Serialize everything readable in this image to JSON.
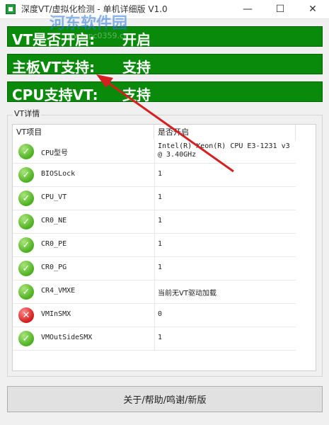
{
  "window": {
    "title": "深度VT/虚拟化检测 - 单机详细版 V1.0",
    "minimize": "—",
    "maximize": "☐",
    "close": "✕"
  },
  "watermark": {
    "text": "河东软件园",
    "url": "www.pc0359.cn"
  },
  "status": [
    {
      "label": "VT是否开启:",
      "value": "开启"
    },
    {
      "label": "主板VT支持:",
      "value": "支持"
    },
    {
      "label": "CPU支持VT:",
      "value": "支持"
    }
  ],
  "details": {
    "group_title": "VT详情",
    "columns": [
      "VT项目",
      "是否开启"
    ],
    "rows": [
      {
        "status": "ok",
        "name": "CPU型号",
        "value": "Intel(R) Xeon(R) CPU E3-1231 v3 @ 3.40GHz"
      },
      {
        "status": "ok",
        "name": "BIOSLock",
        "value": "1"
      },
      {
        "status": "ok",
        "name": "CPU_VT",
        "value": "1"
      },
      {
        "status": "ok",
        "name": "CR0_NE",
        "value": "1"
      },
      {
        "status": "ok",
        "name": "CR0_PE",
        "value": "1"
      },
      {
        "status": "ok",
        "name": "CR0_PG",
        "value": "1"
      },
      {
        "status": "ok",
        "name": "CR4_VMXE",
        "value": "当前无VT驱动加载"
      },
      {
        "status": "error",
        "name": "VMInSMX",
        "value": "0"
      },
      {
        "status": "ok",
        "name": "VMOutSideSMX",
        "value": "1"
      }
    ]
  },
  "footer": {
    "button_label": "关于/帮助/鸣谢/新版"
  },
  "colors": {
    "banner": "#0a8a0a",
    "ok": "#4caf1f",
    "error": "#d21b1b",
    "arrow": "#d42020"
  }
}
